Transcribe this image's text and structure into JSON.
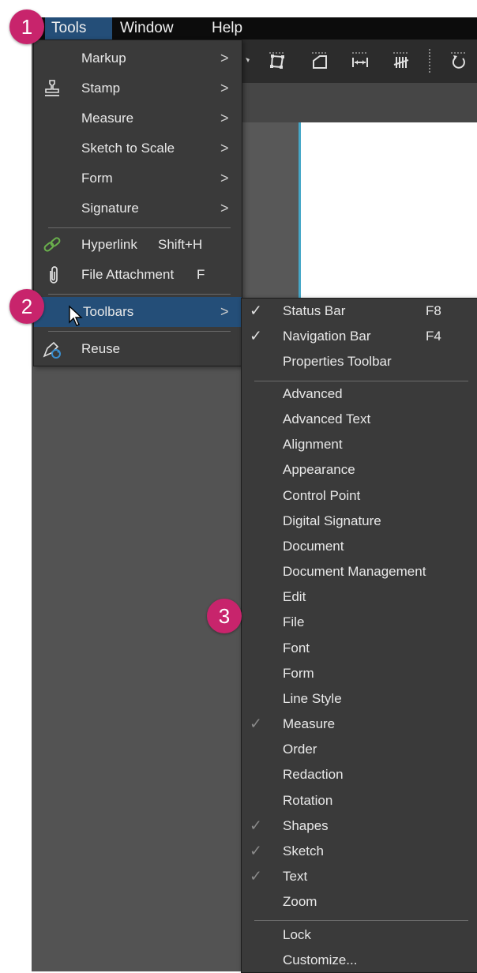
{
  "menubar": {
    "items": [
      {
        "label": "Tools"
      },
      {
        "label": "Window"
      },
      {
        "label": "Help"
      }
    ]
  },
  "tools_menu": {
    "items": [
      {
        "label": "Markup",
        "icon": "none",
        "arrow": ">"
      },
      {
        "label": "Stamp",
        "icon": "stamp-icon",
        "arrow": ">"
      },
      {
        "label": "Measure",
        "icon": "none",
        "arrow": ">"
      },
      {
        "label": "Sketch to Scale",
        "icon": "none",
        "arrow": ">"
      },
      {
        "label": "Form",
        "icon": "none",
        "arrow": ">"
      },
      {
        "label": "Signature",
        "icon": "none",
        "arrow": ">"
      },
      {
        "label": "Hyperlink",
        "shortcut": "Shift+H",
        "icon": "link-icon"
      },
      {
        "label": "File Attachment",
        "shortcut": "F",
        "icon": "paperclip-icon"
      },
      {
        "label": "Toolbars",
        "icon": "none",
        "arrow": ">",
        "highlighted": true
      },
      {
        "label": "Reuse",
        "icon": "reuse-icon"
      }
    ]
  },
  "toolbars_menu": {
    "items": [
      {
        "label": "Status Bar",
        "shortcut": "F8",
        "checked": true
      },
      {
        "label": "Navigation Bar",
        "shortcut": "F4",
        "checked": true
      },
      {
        "label": "Properties Toolbar",
        "checked": false
      },
      {
        "label": "Advanced",
        "checked": false
      },
      {
        "label": "Advanced Text",
        "checked": false
      },
      {
        "label": "Alignment",
        "checked": false
      },
      {
        "label": "Appearance",
        "checked": false
      },
      {
        "label": "Control Point",
        "checked": false
      },
      {
        "label": "Digital Signature",
        "checked": false
      },
      {
        "label": "Document",
        "checked": false
      },
      {
        "label": "Document Management",
        "checked": false
      },
      {
        "label": "Edit",
        "checked": false
      },
      {
        "label": "File",
        "checked": false
      },
      {
        "label": "Font",
        "checked": false
      },
      {
        "label": "Form",
        "checked": false
      },
      {
        "label": "Line Style",
        "checked": false
      },
      {
        "label": "Measure",
        "checked": true
      },
      {
        "label": "Order",
        "checked": false
      },
      {
        "label": "Redaction",
        "checked": false
      },
      {
        "label": "Rotation",
        "checked": false
      },
      {
        "label": "Shapes",
        "checked": true
      },
      {
        "label": "Sketch",
        "checked": true
      },
      {
        "label": "Text",
        "checked": true
      },
      {
        "label": "Zoom",
        "checked": false
      },
      {
        "label": "Lock",
        "checked": false
      },
      {
        "label": "Customize...",
        "checked": false
      }
    ]
  },
  "check_mark": "✓",
  "badges": [
    {
      "label": "1"
    },
    {
      "label": "2"
    },
    {
      "label": "3"
    }
  ],
  "colors": {
    "menu_bg": "#3a3a3a",
    "highlight": "#244e78",
    "badge": "#c8246c",
    "menubar": "#0c0c0c"
  }
}
